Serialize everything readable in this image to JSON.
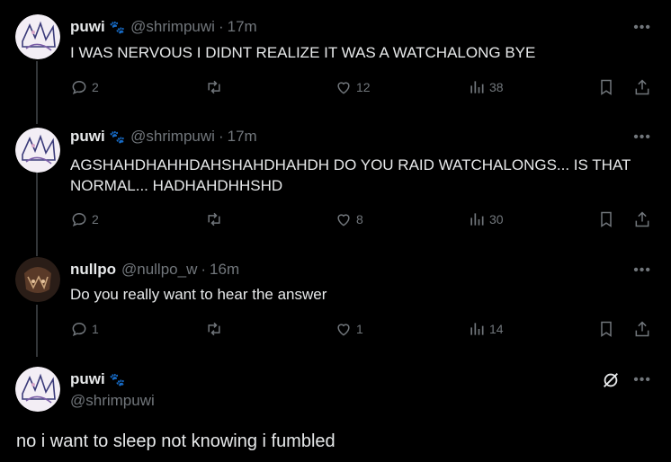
{
  "tweets": [
    {
      "name": "puwi",
      "handle": "@shrimpuwi",
      "time": "17m",
      "text": "I WAS NERVOUS I DIDNT REALIZE IT WAS A WATCHALONG BYE",
      "replies": "2",
      "likes": "12",
      "views": "38"
    },
    {
      "name": "puwi",
      "handle": "@shrimpuwi",
      "time": "17m",
      "text": "AGSHAHDHAHHDAHSHAHDHAHDH DO YOU RAID WATCHALONGS... IS THAT NORMAL... HADHAHDHHSHD",
      "replies": "2",
      "likes": "8",
      "views": "30"
    },
    {
      "name": "nullpo",
      "handle": "@nullpo_w",
      "time": "16m",
      "text": "Do you really want to hear the answer",
      "replies": "1",
      "likes": "1",
      "views": "14"
    }
  ],
  "focused": {
    "name": "puwi",
    "handle": "@shrimpuwi",
    "text": "no i want to sleep not knowing i fumbled"
  },
  "separator": "·",
  "more_glyph": "•••",
  "icons": [
    "reply-icon",
    "retweet-icon",
    "like-icon",
    "views-icon",
    "bookmark-icon",
    "share-icon",
    "grok-icon",
    "more-icon"
  ],
  "colors": {
    "background": "#000000",
    "text": "#e7e9ea",
    "muted": "#71767b",
    "paw": "#c2410c"
  }
}
